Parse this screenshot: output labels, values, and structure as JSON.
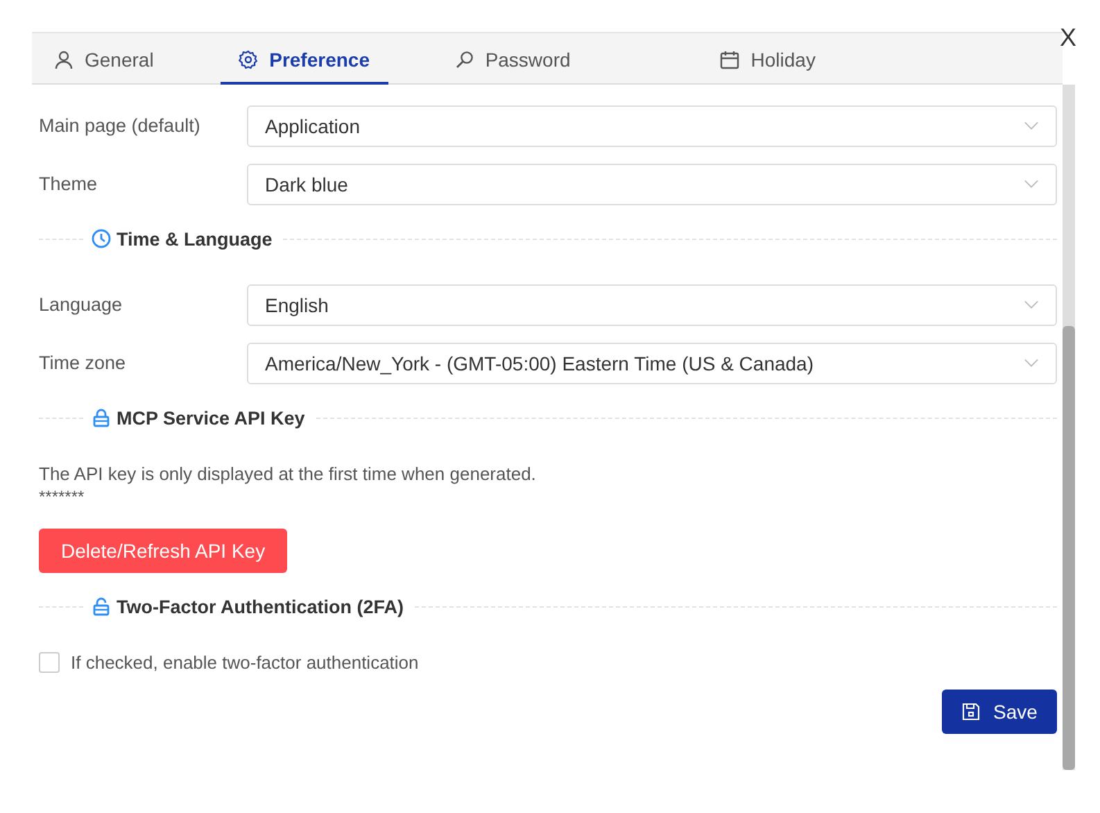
{
  "tabs": [
    {
      "label": "General",
      "selected": false
    },
    {
      "label": "Preference",
      "selected": true
    },
    {
      "label": "Password",
      "selected": false
    },
    {
      "label": "Holiday",
      "selected": false
    }
  ],
  "close": "X",
  "blocks": [
    {
      "kind": "select",
      "label": "Main page (default)",
      "value": "Application"
    },
    {
      "kind": "select",
      "label": "Theme",
      "value": "Dark blue"
    },
    {
      "kind": "section",
      "title": "Time & Language"
    },
    {
      "kind": "select",
      "label": "Language",
      "value": "English"
    },
    {
      "kind": "select",
      "label": "Time zone",
      "value": "America/New_York - (GMT-05:00) Eastern Time (US & Canada)"
    },
    {
      "kind": "section",
      "title": "MCP Service API Key"
    },
    {
      "kind": "note",
      "text": "The API key is only displayed at the first time when generated.",
      "masked": "*******"
    },
    {
      "kind": "danger",
      "label": "Delete/Refresh API Key"
    },
    {
      "kind": "section",
      "title": "Two-Factor Authentication (2FA)"
    },
    {
      "kind": "checkbox",
      "label": "If checked, enable two-factor authentication",
      "checked": false
    }
  ],
  "save": "Save"
}
